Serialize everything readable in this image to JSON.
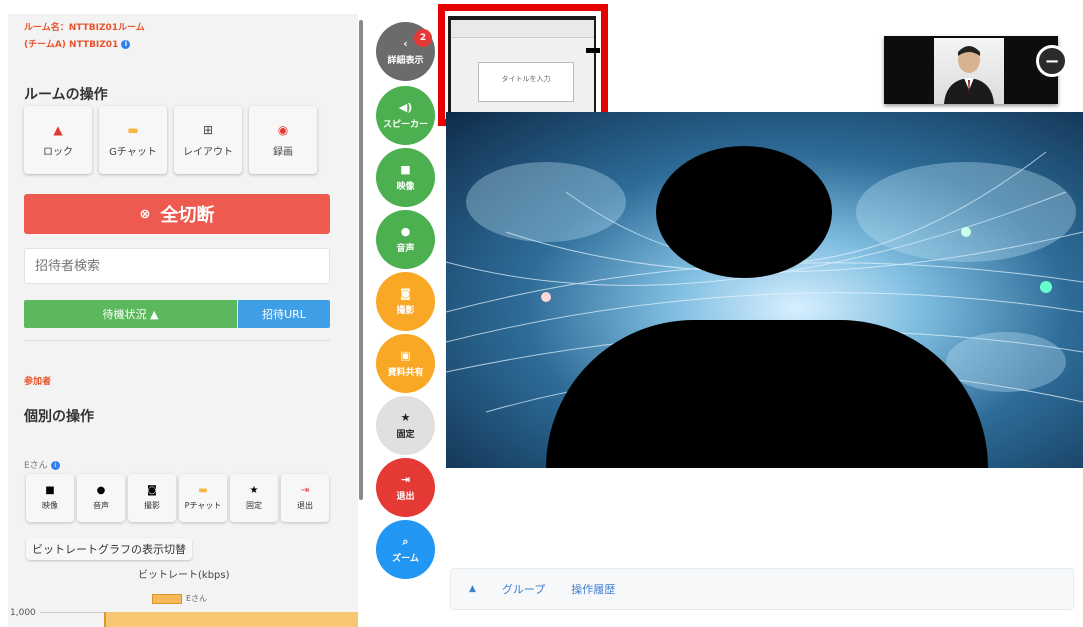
{
  "room": {
    "name_line": "ルーム名：NTTBIZ01ルーム",
    "team_line": "(チームA) NTTBIZ01",
    "info_icon": "i"
  },
  "room_ops": {
    "title": "ルームの操作",
    "items": [
      {
        "label": "ロック",
        "icon": "lock-icon",
        "glyph": "🔒",
        "color": "#e53935"
      },
      {
        "label": "Gチャット",
        "icon": "chat-icon",
        "glyph": "▬",
        "color": "#f5b642"
      },
      {
        "label": "レイアウト",
        "icon": "layout-icon",
        "glyph": "⊞",
        "color": "#444444"
      },
      {
        "label": "録画",
        "icon": "record-icon",
        "glyph": "◉",
        "color": "#e53935"
      }
    ]
  },
  "disconnect": {
    "label": "全切断",
    "icon_glyph": "⊗"
  },
  "search": {
    "placeholder": "招待者検索"
  },
  "wait_status": {
    "label": "待機状況 ▲"
  },
  "invite_url": {
    "label": "招待URL"
  },
  "participants": {
    "label": "参加者"
  },
  "individual_ops": {
    "title": "個別の操作",
    "user": "Eさん",
    "items": [
      {
        "label": "映像",
        "icon": "video-icon",
        "glyph": "■",
        "color": "#222222"
      },
      {
        "label": "音声",
        "icon": "mic-icon",
        "glyph": "🎤",
        "color": "#222222"
      },
      {
        "label": "撮影",
        "icon": "camera-icon",
        "glyph": "◙",
        "color": "#222222"
      },
      {
        "label": "Pチャット",
        "icon": "chat-icon",
        "glyph": "▬",
        "color": "#f5b642"
      },
      {
        "label": "固定",
        "icon": "star-icon",
        "glyph": "★",
        "color": "#222222"
      },
      {
        "label": "退出",
        "icon": "exit-icon",
        "glyph": "⇥",
        "color": "#e53935"
      }
    ]
  },
  "bitrate": {
    "toggle_label": "ビットレートグラフの表示切替",
    "graph_title": "ビットレート(kbps)",
    "legend": "Eさん",
    "y_tick": "1,000"
  },
  "side_controls": [
    {
      "label": "詳細表示",
      "glyph": "‹",
      "icon": "chevron-left-icon",
      "color": "#6b6b6b",
      "badge": "2"
    },
    {
      "label": "スピーカー",
      "glyph": "🔊",
      "icon": "speaker-icon",
      "color": "#4caf50"
    },
    {
      "label": "映像",
      "glyph": "■",
      "icon": "video-icon",
      "color": "#4caf50"
    },
    {
      "label": "音声",
      "glyph": "🎤",
      "icon": "mic-icon",
      "color": "#4caf50"
    },
    {
      "label": "撮影",
      "glyph": "◙",
      "icon": "camera-icon",
      "color": "#f9a825"
    },
    {
      "label": "資料共有",
      "glyph": "▣",
      "icon": "share-icon",
      "color": "#f9a825"
    },
    {
      "label": "固定",
      "glyph": "★",
      "icon": "star-icon",
      "color": "#e0e0e0",
      "text_color": "#222222"
    },
    {
      "label": "退出",
      "glyph": "⇥",
      "icon": "exit-icon",
      "color": "#e53935"
    },
    {
      "label": "ズーム",
      "glyph": "🔍",
      "icon": "zoom-icon",
      "color": "#2196f3"
    }
  ],
  "thumbnail": {
    "slide_text": "タイトルを入力"
  },
  "bottom_bar": {
    "group": "グループ",
    "history": "操作履歴"
  }
}
